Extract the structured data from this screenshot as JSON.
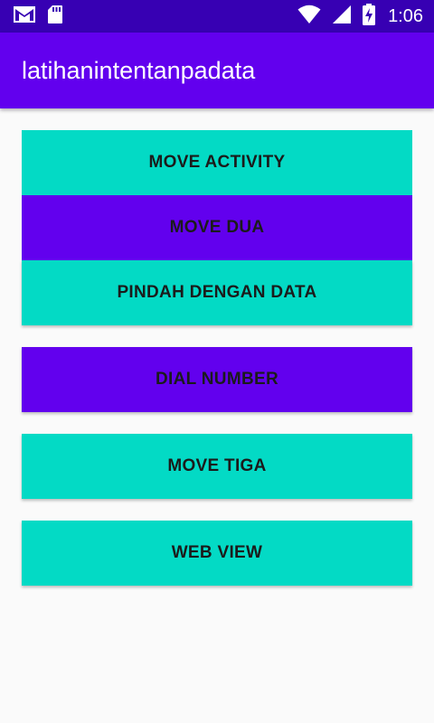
{
  "status_bar": {
    "time": "1:06",
    "icons": [
      "gmail-icon",
      "sd-card-icon",
      "wifi-icon",
      "signal-icon",
      "battery-charging-icon"
    ]
  },
  "app_bar": {
    "title": "latihanintentanpadata"
  },
  "buttons": [
    {
      "label": "MOVE ACTIVITY",
      "color": "#03dac5"
    },
    {
      "label": "MOVE DUA",
      "color": "#6200ee"
    },
    {
      "label": "PINDAH DENGAN DATA",
      "color": "#03dac5"
    },
    {
      "label": "DIAL NUMBER",
      "color": "#6200ee"
    },
    {
      "label": "MOVE TIGA",
      "color": "#03dac5"
    },
    {
      "label": "WEB VIEW",
      "color": "#03dac5"
    }
  ],
  "colors": {
    "status_bar": "#3700b3",
    "primary": "#6200ee",
    "accent": "#03dac5",
    "background": "#fafafa"
  }
}
